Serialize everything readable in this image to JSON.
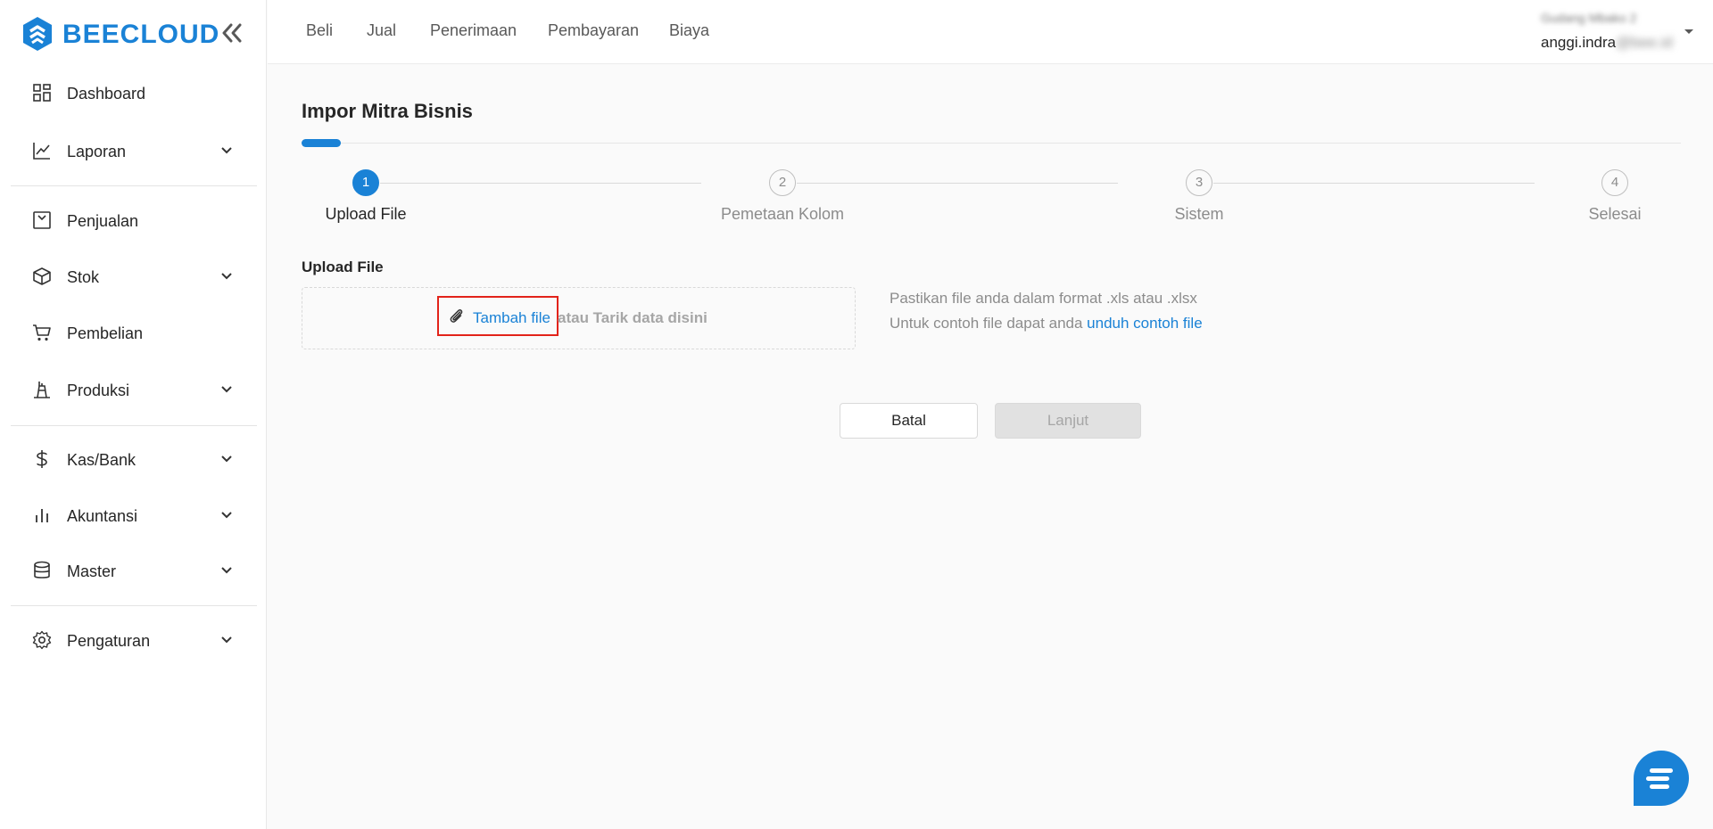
{
  "brand": {
    "name": "BEECLOUD",
    "color": "#1a82d6"
  },
  "sidebar": {
    "items": [
      {
        "key": "dashboard",
        "label": "Dashboard",
        "icon": "dashboard-grid-icon",
        "has_submenu": false
      },
      {
        "key": "laporan",
        "label": "Laporan",
        "icon": "line-chart-icon",
        "has_submenu": true
      },
      {
        "key": "penjualan",
        "label": "Penjualan",
        "icon": "receipt-icon",
        "has_submenu": false
      },
      {
        "key": "stok",
        "label": "Stok",
        "icon": "box-icon",
        "has_submenu": true
      },
      {
        "key": "pembelian",
        "label": "Pembelian",
        "icon": "cart-icon",
        "has_submenu": false
      },
      {
        "key": "produksi",
        "label": "Produksi",
        "icon": "factory-icon",
        "has_submenu": true
      },
      {
        "key": "kasbank",
        "label": "Kas/Bank",
        "icon": "dollar-icon",
        "has_submenu": true
      },
      {
        "key": "akuntansi",
        "label": "Akuntansi",
        "icon": "bar-chart-icon",
        "has_submenu": true
      },
      {
        "key": "master",
        "label": "Master",
        "icon": "database-icon",
        "has_submenu": true
      },
      {
        "key": "pengaturan",
        "label": "Pengaturan",
        "icon": "gear-icon",
        "has_submenu": true
      }
    ]
  },
  "topnav": {
    "links": [
      "Beli",
      "Jual",
      "Penerimaan",
      "Pembayaran",
      "Biaya"
    ],
    "user": {
      "company": "Gudang Mbako 2",
      "email_visible": "anggi.indra",
      "email_hidden": "@bee.id"
    }
  },
  "page": {
    "title": "Impor Mitra Bisnis",
    "steps": [
      {
        "number": "1",
        "label": "Upload File",
        "active": true
      },
      {
        "number": "2",
        "label": "Pemetaan Kolom",
        "active": false
      },
      {
        "number": "3",
        "label": "Sistem",
        "active": false
      },
      {
        "number": "4",
        "label": "Selesai",
        "active": false
      }
    ],
    "upload": {
      "heading": "Upload File",
      "add_file": "Tambah file",
      "or_drag": "atau Tarik data disini",
      "hint_format": "Pastikan file anda dalam format .xls atau .xlsx",
      "hint_example_prefix": "Untuk contoh file dapat anda ",
      "hint_example_link": "unduh contoh file"
    },
    "buttons": {
      "cancel": "Batal",
      "next": "Lanjut"
    }
  }
}
